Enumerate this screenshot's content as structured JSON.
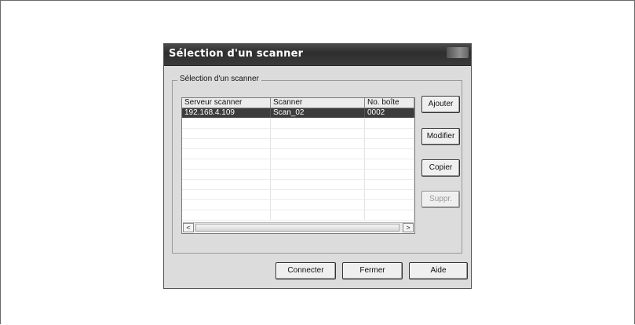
{
  "dialog": {
    "title": "Sélection d'un scanner",
    "group_label": "Sélection d'un scanner"
  },
  "list": {
    "columns": [
      "Serveur scanner",
      "Scanner",
      "No. boîte"
    ],
    "rows": [
      {
        "server": "192.168.4.109",
        "scanner": "Scan_02",
        "box": "0002",
        "selected": true
      }
    ]
  },
  "side_buttons": {
    "add": "Ajouter",
    "edit": "Modifier",
    "copy": "Copier",
    "delete": "Suppr."
  },
  "bottom_buttons": {
    "connect": "Connecter",
    "close": "Fermer",
    "help": "Aide"
  },
  "scrollbar": {
    "left_arrow": "<",
    "right_arrow": ">"
  }
}
